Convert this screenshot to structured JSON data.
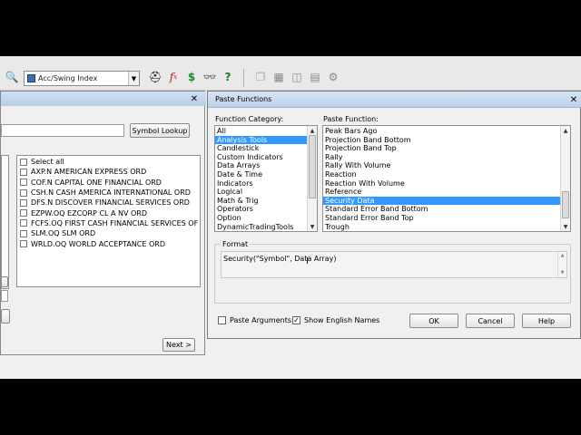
{
  "toolbar": {
    "indicator_combo": "Acc/Swing Index"
  },
  "symbol_dialog": {
    "symbol_lookup_label": "Symbol Lookup",
    "next_label": "Next >",
    "checklist": [
      "Select all",
      "AXP.N  AMERICAN EXPRESS ORD",
      "COF.N  CAPITAL ONE FINANCIAL ORD",
      "CSH.N  CASH AMERICA INTERNATIONAL ORD",
      "DFS.N  DISCOVER FINANCIAL SERVICES ORD",
      "EZPW.OQ  EZCORP CL A NV ORD",
      "FCFS.OQ  FIRST CASH FINANCIAL SERVICES OF",
      "SLM.OQ  SLM ORD",
      "WRLD.OQ  WORLD ACCEPTANCE ORD"
    ]
  },
  "paste_functions": {
    "title": "Paste Functions",
    "category_label": "Function Category:",
    "categories": [
      "All",
      "Analysis Tools",
      "Candlestick",
      "Custom Indicators",
      "Data Arrays",
      "Date & Time",
      "Indicators",
      "Logical",
      "Math & Trig",
      "Operators",
      "Option",
      "DynamicTradingTools"
    ],
    "selected_category": "Analysis Tools",
    "function_label": "Paste Function:",
    "functions": [
      "Peak Bars Ago",
      "Projection Band Bottom",
      "Projection Band Top",
      "Rally",
      "Rally With Volume",
      "Reaction",
      "Reaction With Volume",
      "Reference",
      "Security Data",
      "Standard Error Band Bottom",
      "Standard Error Band Top",
      "Trough"
    ],
    "selected_function": "Security Data",
    "format_label": "Format",
    "format_text": "Security(\"Symbol\", Data Array)",
    "paste_arguments_label": "Paste Arguments",
    "paste_arguments_checked": false,
    "show_english_label": "Show English Names",
    "show_english_checked": true,
    "ok_label": "OK",
    "cancel_label": "Cancel",
    "help_label": "Help"
  },
  "colors": {
    "selection": "#3399ff",
    "title_bar": "#c4d7ee"
  }
}
